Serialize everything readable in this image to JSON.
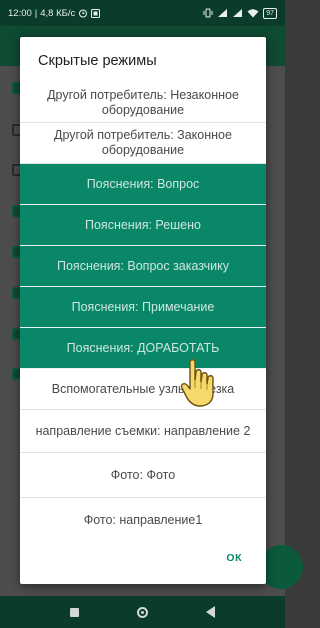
{
  "status_bar": {
    "time": "12:00",
    "network_speed": "4,8 КБ/с",
    "battery": "97"
  },
  "dialog": {
    "title": "Скрытые режимы",
    "items": [
      {
        "label": "Другой потребитель: Незаконное оборудование",
        "selected": false
      },
      {
        "label": "Другой потребитель: Законное оборудование",
        "selected": false
      },
      {
        "label": "Пояснения: Вопрос",
        "selected": true
      },
      {
        "label": "Пояснения: Решено",
        "selected": true
      },
      {
        "label": "Пояснения: Вопрос заказчику",
        "selected": true
      },
      {
        "label": "Пояснения: Примечание",
        "selected": true
      },
      {
        "label": "Пояснения: ДОРАБОТАТЬ",
        "selected": true
      },
      {
        "label": "Вспомогательные узлы: Врезка",
        "selected": false
      },
      {
        "label": "направление съемки: направление 2",
        "selected": false
      },
      {
        "label": "Фото: Фото",
        "selected": false
      },
      {
        "label": "Фото: направление1",
        "selected": false
      }
    ],
    "ok_label": "ОК"
  },
  "colors": {
    "accent": "#0a8769",
    "status_bar": "#0b3b2a"
  },
  "icons": [
    "alarm-icon",
    "app-notification-icon",
    "vibrate-icon",
    "signal-icon",
    "wifi-icon",
    "battery-icon",
    "pointer-hand-icon"
  ]
}
